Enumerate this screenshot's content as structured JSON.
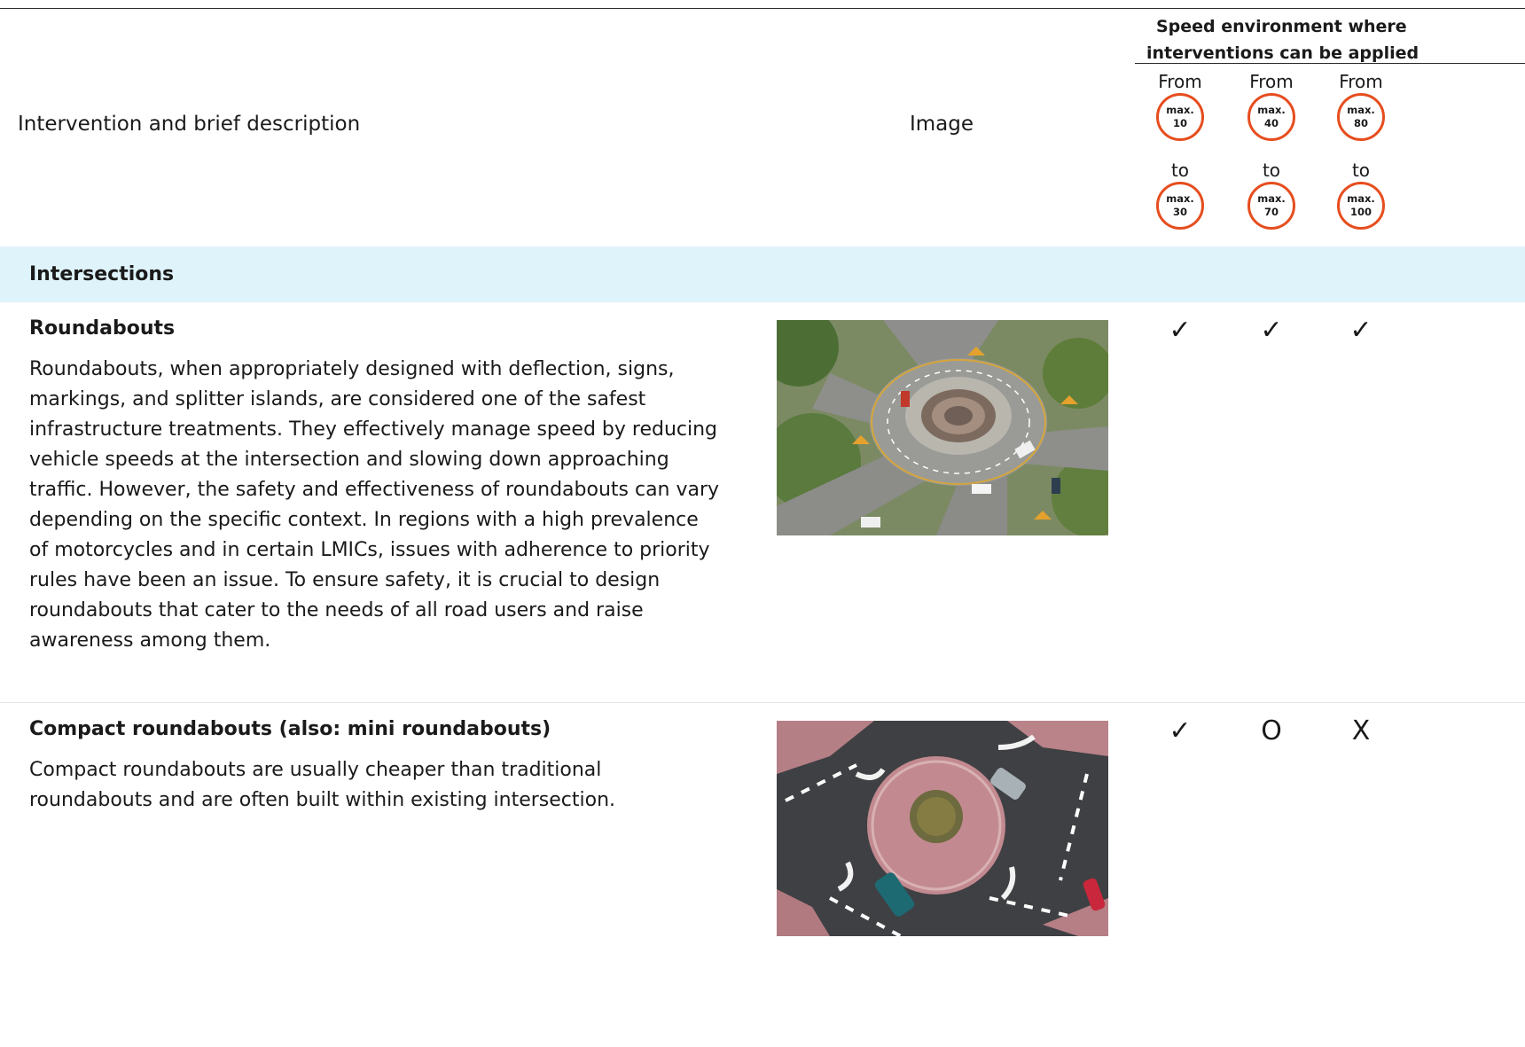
{
  "header": {
    "description_label": "Intervention and brief description",
    "image_label": "Image",
    "speed_title_line1": "Speed environment where",
    "speed_title_line2": "interventions can be applied",
    "columns": [
      {
        "from_word": "From",
        "from_max": "max.",
        "from_value": "10",
        "to_word": "to",
        "to_max": "max.",
        "to_value": "30"
      },
      {
        "from_word": "From",
        "from_max": "max.",
        "from_value": "40",
        "to_word": "to",
        "to_max": "max.",
        "to_value": "70"
      },
      {
        "from_word": "From",
        "from_max": "max.",
        "from_value": "80",
        "to_word": "to",
        "to_max": "max.",
        "to_value": "100"
      }
    ]
  },
  "section": {
    "label": "Intersections",
    "color": "#dff3fb"
  },
  "accent_color": "#e64d1e",
  "rows": [
    {
      "title": "Roundabouts",
      "description": "Roundabouts, when appropriately designed with deflection, signs, markings, and splitter islands, are considered one of the safest infrastructure treatments. They effectively manage speed by reducing vehicle speeds at the intersection and slowing down approaching traffic. However, the safety and effectiveness of roundabouts can vary depending on the specific context. In regions with a high prevalence of motorcycles and in certain LMICs, issues with adherence to priority rules have been an issue. To ensure safety, it is crucial to design roundabouts that cater to the needs of all road users and raise awareness among them.",
      "marks": [
        "✓",
        "✓",
        "✓"
      ]
    },
    {
      "title": "Compact roundabouts (also: mini roundabouts)",
      "description": "Compact roundabouts are usually cheaper than traditional roundabouts and are often built within existing intersection.",
      "marks": [
        "✓",
        "O",
        "X"
      ]
    }
  ]
}
